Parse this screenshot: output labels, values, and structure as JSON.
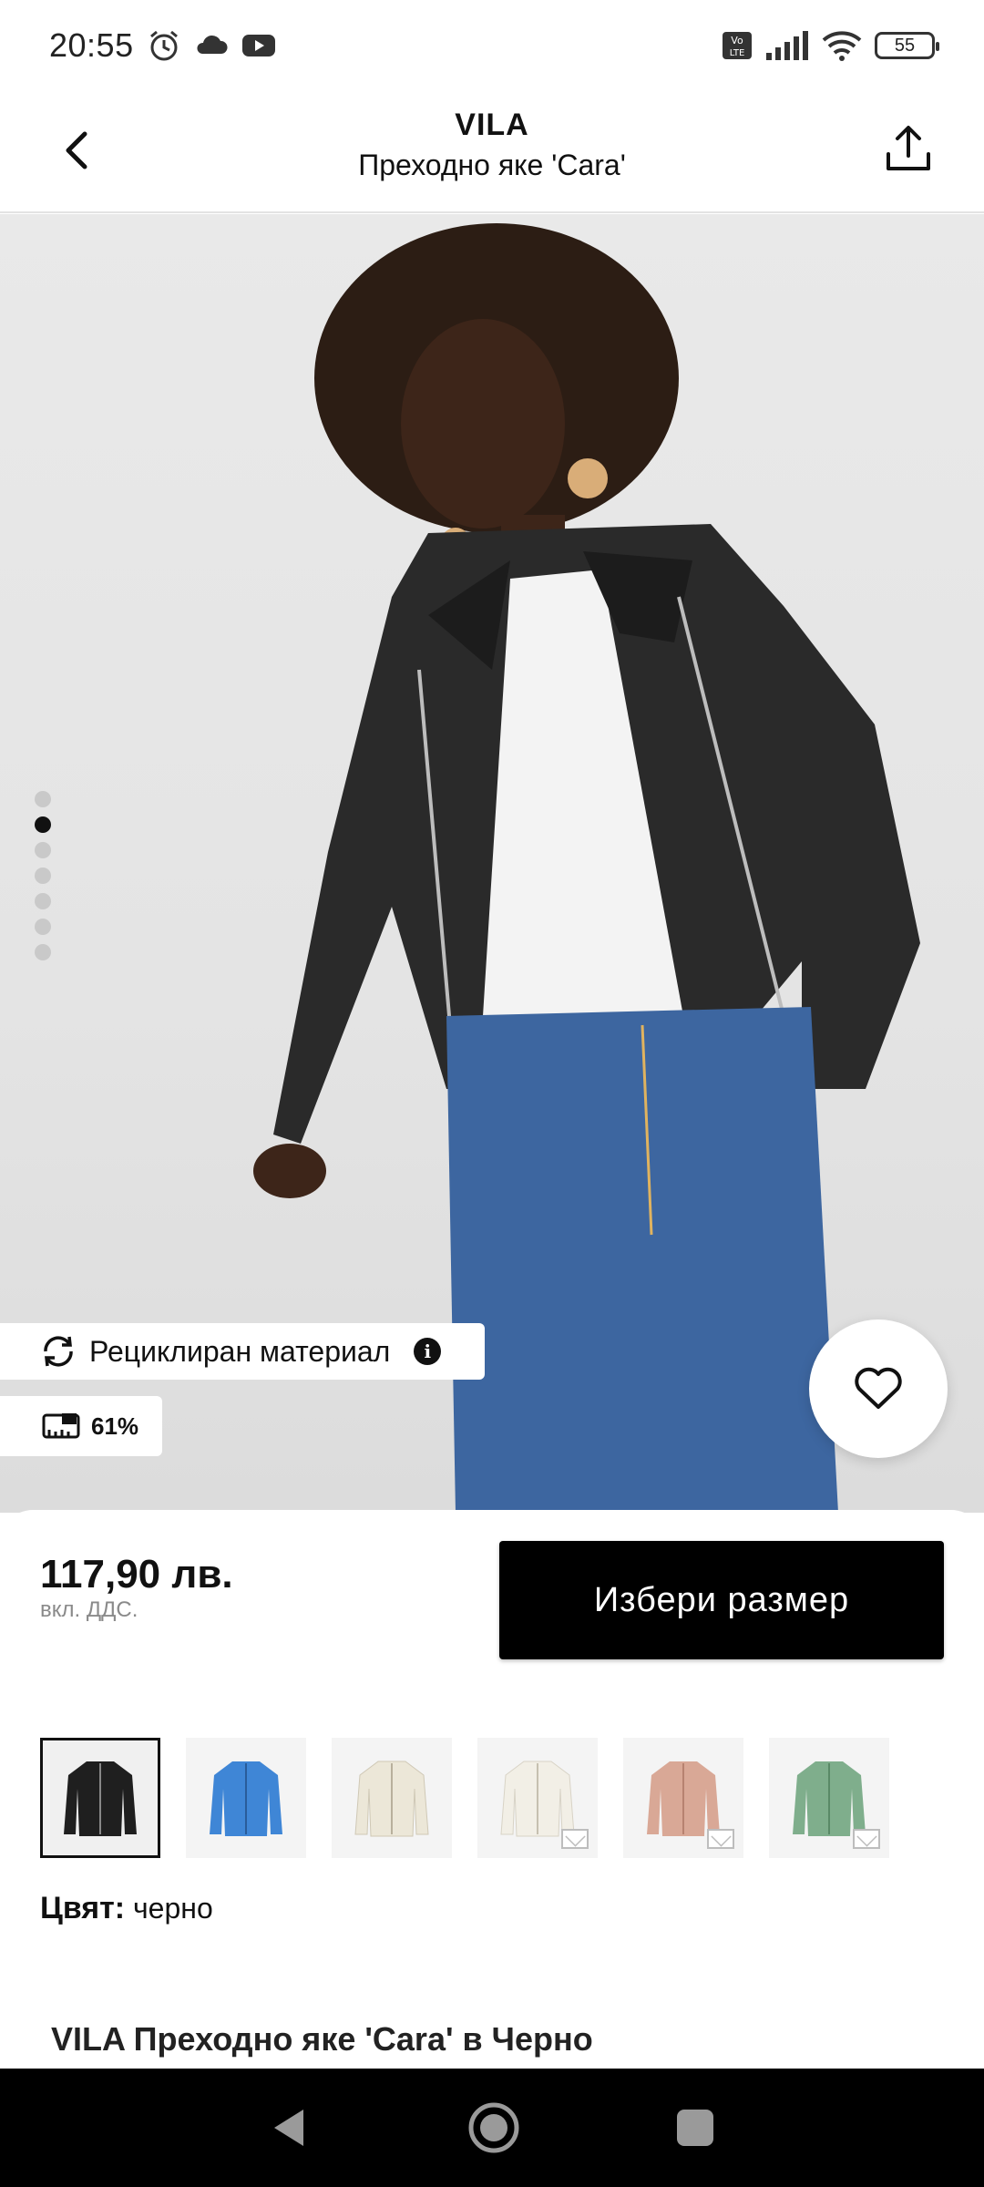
{
  "status_bar": {
    "time": "20:55",
    "battery": "55",
    "icons": [
      "alarm-icon",
      "cloud-icon",
      "youtube-icon",
      "volte-icon",
      "signal-icon",
      "wifi-icon",
      "battery-icon"
    ]
  },
  "header": {
    "brand": "VILA",
    "title": "Преходно яке 'Cara'"
  },
  "hero": {
    "image_count": 7,
    "active_index": 1,
    "recycled_label": "Рециклиран материал",
    "recycled_percent": "61%"
  },
  "product": {
    "price": "117,90 лв.",
    "vat_note": "вкл. ДДС.",
    "size_button_label": "Избери размер",
    "color_label": "Цвят:",
    "color_value": "черно",
    "full_title": "VILA Преходно яке 'Cara' в Черно"
  },
  "variants": [
    {
      "color": "#1f1f1f",
      "selected": true,
      "mail_marker": false
    },
    {
      "color": "#3f86d6",
      "selected": false,
      "mail_marker": false
    },
    {
      "color": "#ece7d8",
      "selected": false,
      "mail_marker": false
    },
    {
      "color": "#f2efe6",
      "selected": false,
      "mail_marker": true
    },
    {
      "color": "#d9a896",
      "selected": false,
      "mail_marker": true
    },
    {
      "color": "#7fae8c",
      "selected": false,
      "mail_marker": true
    }
  ],
  "colors": {
    "accent": "#000000",
    "muted_text": "#8a8a8a",
    "background_hero": "#e6e6e6"
  }
}
